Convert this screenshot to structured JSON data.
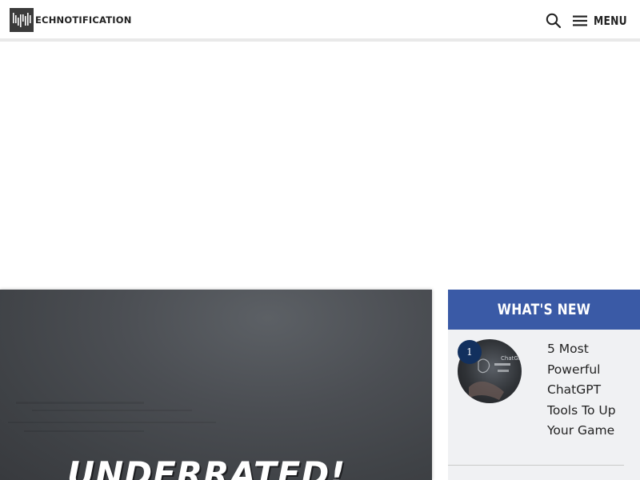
{
  "header": {
    "logo_text": "ECHNOTIFICATION",
    "menu_label": "MENU"
  },
  "hero": {
    "overlay_text": "UNDERRATED!"
  },
  "sidebar": {
    "title": "WHAT'S NEW",
    "items": [
      {
        "rank": "1",
        "title": "5 Most Powerful ChatGPT Tools To Up Your Game",
        "thumb_text": "ChatGPT"
      }
    ]
  },
  "colors": {
    "sidebar_header": "#3a5aa6",
    "badge": "#12305e",
    "sidebar_bg": "#f0f1f3"
  }
}
